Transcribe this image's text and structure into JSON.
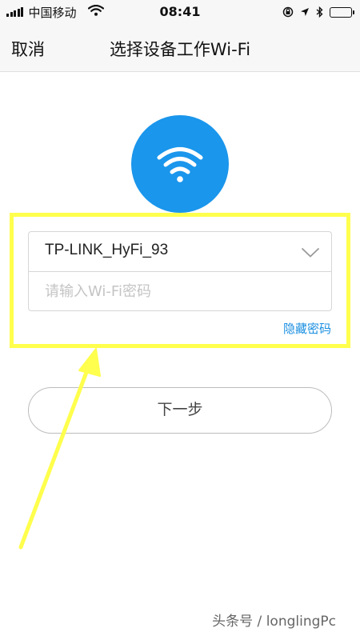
{
  "status_bar": {
    "carrier": "中国移动",
    "time": "08:41",
    "battery_level": 0.8
  },
  "nav": {
    "cancel_label": "取消",
    "title": "选择设备工作Wi-Fi"
  },
  "form": {
    "ssid_value": "TP-LINK_HyFi_93",
    "password_placeholder": "请输入Wi-Fi密码",
    "password_value": "",
    "hide_password_label": "隐藏密码"
  },
  "actions": {
    "next_label": "下一步"
  },
  "watermark": {
    "text": "头条号 / longlingPc"
  },
  "colors": {
    "accent_blue": "#1a96ec",
    "link_blue": "#1a8fe0",
    "annotation_yellow": "#ffff4d"
  },
  "icons": {
    "wifi_hero": "wifi-icon",
    "dropdown": "chevron-down-icon"
  }
}
